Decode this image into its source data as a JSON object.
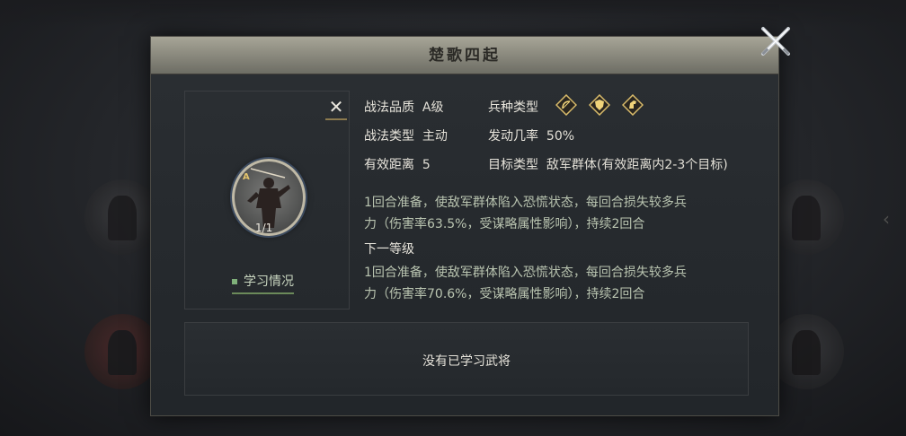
{
  "dialog": {
    "title": "楚歌四起",
    "close_icon": "crossed-swords-close-icon"
  },
  "skill": {
    "rank": "A",
    "level": "1/1",
    "study_label": "学习情况",
    "remove_icon": "x-icon"
  },
  "attributes": {
    "quality_label": "战法品质",
    "quality_value": "A级",
    "troop_label": "兵种类型",
    "troop_icons": [
      "bow-icon",
      "shield-icon",
      "horse-icon"
    ],
    "type_label": "战法类型",
    "type_value": "主动",
    "rate_label": "发动几率",
    "rate_value": "50%",
    "range_label": "有效距离",
    "range_value": "5",
    "target_label": "目标类型",
    "target_value": "敌军群体(有效距离内2-3个目标)"
  },
  "description": {
    "current_line1": "1回合准备，使敌军群体陷入恐慌状态，每回合损失较多兵",
    "current_line2": "力（伤害率63.5%，受谋略属性影响），持续2回合",
    "next_title": "下一等级",
    "next_line1": "1回合准备，使敌军群体陷入恐慌状态，每回合损失较多兵",
    "next_line2": "力（伤害率70.6%，受谋略属性影响），持续2回合"
  },
  "generals": {
    "empty_text": "没有已学习武将"
  },
  "colors": {
    "accent_gold": "#e3c46c",
    "header": "#8d8c80",
    "desc_text": "#b9c4b0"
  }
}
